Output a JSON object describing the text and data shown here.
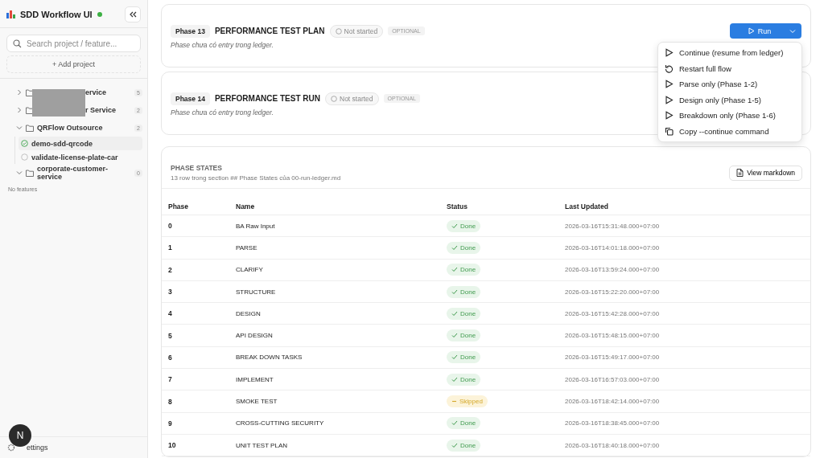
{
  "app": {
    "title": "SDD Workflow UI"
  },
  "search": {
    "placeholder": "Search project / feature..."
  },
  "add_project": "+ Add project",
  "projects": [
    {
      "name": "ervice",
      "count": "5",
      "expanded": false
    },
    {
      "name": "r Service",
      "count": "2",
      "expanded": false
    },
    {
      "name": "QRFlow Outsource",
      "count": "2",
      "expanded": true,
      "children": [
        {
          "name": "demo-sdd-qrcode",
          "kind": "done",
          "selected": true
        },
        {
          "name": "validate-license-plate-car",
          "kind": "pending",
          "selected": false
        }
      ]
    },
    {
      "name": "corporate-customer-service",
      "count": "0",
      "expanded": true,
      "empty_text": "No features"
    }
  ],
  "settings": "ettings",
  "avatar": "N",
  "phases": [
    {
      "badge": "Phase 13",
      "title": "PERFORMANCE TEST PLAN",
      "status": "Not started",
      "tag": "OPTIONAL",
      "note": "Phase chưa có entry trong ledger.",
      "run": "Run"
    },
    {
      "badge": "Phase 14",
      "title": "PERFORMANCE TEST RUN",
      "status": "Not started",
      "tag": "OPTIONAL",
      "note": "Phase chưa có entry trong ledger."
    }
  ],
  "run_menu": [
    {
      "kind": "play",
      "label": "Continue (resume from ledger)"
    },
    {
      "kind": "restart",
      "label": "Restart full flow"
    },
    {
      "kind": "play",
      "label": "Parse only (Phase 1-2)"
    },
    {
      "kind": "play",
      "label": "Design only (Phase 1-5)"
    },
    {
      "kind": "play",
      "label": "Breakdown only (Phase 1-6)"
    },
    {
      "kind": "copy",
      "label": "Copy --continue command"
    }
  ],
  "phase_states": {
    "title": "PHASE STATES",
    "subtitle": "13 row trong section ## Phase States của 00-run-ledger.md",
    "button": "View markdown",
    "columns": [
      "Phase",
      "Name",
      "Status",
      "Last Updated"
    ],
    "rows": [
      {
        "phase": "0",
        "name": "BA Raw Input",
        "kind": "done",
        "status": "Done",
        "updated": "2026-03-16T15:31:48.000+07:00"
      },
      {
        "phase": "1",
        "name": "PARSE",
        "kind": "done",
        "status": "Done",
        "updated": "2026-03-16T14:01:18.000+07:00"
      },
      {
        "phase": "2",
        "name": "CLARIFY",
        "kind": "done",
        "status": "Done",
        "updated": "2026-03-16T13:59:24.000+07:00"
      },
      {
        "phase": "3",
        "name": "STRUCTURE",
        "kind": "done",
        "status": "Done",
        "updated": "2026-03-16T15:22:20.000+07:00"
      },
      {
        "phase": "4",
        "name": "DESIGN",
        "kind": "done",
        "status": "Done",
        "updated": "2026-03-16T15:42:28.000+07:00"
      },
      {
        "phase": "5",
        "name": "API DESIGN",
        "kind": "done",
        "status": "Done",
        "updated": "2026-03-16T15:48:15.000+07:00"
      },
      {
        "phase": "6",
        "name": "BREAK DOWN TASKS",
        "kind": "done",
        "status": "Done",
        "updated": "2026-03-16T15:49:17.000+07:00"
      },
      {
        "phase": "7",
        "name": "IMPLEMENT",
        "kind": "done",
        "status": "Done",
        "updated": "2026-03-16T16:57:03.000+07:00"
      },
      {
        "phase": "8",
        "name": "SMOKE TEST",
        "kind": "skipped",
        "status": "Skipped",
        "updated": "2026-03-16T18:42:14.000+07:00"
      },
      {
        "phase": "9",
        "name": "CROSS-CUTTING SECURITY",
        "kind": "done",
        "status": "Done",
        "updated": "2026-03-16T18:38:45.000+07:00"
      },
      {
        "phase": "10",
        "name": "UNIT TEST PLAN",
        "kind": "done",
        "status": "Done",
        "updated": "2026-03-16T18:40:18.000+07:00"
      }
    ]
  }
}
